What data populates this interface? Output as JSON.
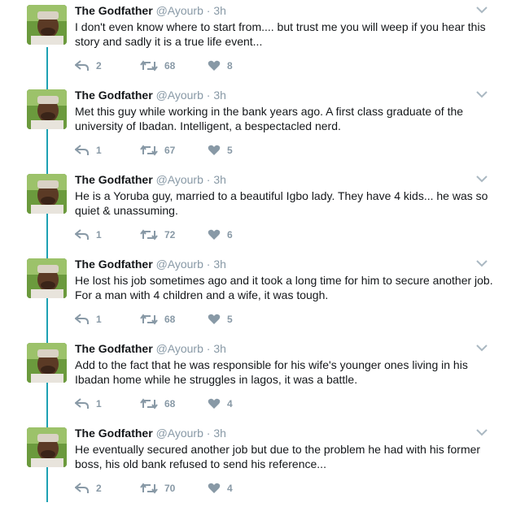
{
  "thread": {
    "tweets": [
      {
        "name": "The Godfather",
        "handle": "@Ayourb",
        "dot": "·",
        "time": "3h",
        "text": "I don't even know where to start from.... but trust me you will weep if you hear this story and sadly it is a true life event...",
        "replies": "2",
        "retweets": "68",
        "likes": "8"
      },
      {
        "name": "The Godfather",
        "handle": "@Ayourb",
        "dot": "·",
        "time": "3h",
        "text": "Met this guy while working in the bank years ago. A first class graduate of the university of Ibadan. Intelligent, a bespectacled nerd.",
        "replies": "1",
        "retweets": "67",
        "likes": "5"
      },
      {
        "name": "The Godfather",
        "handle": "@Ayourb",
        "dot": "·",
        "time": "3h",
        "text": "He is a Yoruba guy, married to a beautiful Igbo lady. They have 4 kids... he was so quiet & unassuming.",
        "replies": "1",
        "retweets": "72",
        "likes": "6"
      },
      {
        "name": "The Godfather",
        "handle": "@Ayourb",
        "dot": "·",
        "time": "3h",
        "text": "He lost his job sometimes ago and it took a long time for him to secure another job. For a man with 4 children and a wife, it was tough.",
        "replies": "1",
        "retweets": "68",
        "likes": "5"
      },
      {
        "name": "The Godfather",
        "handle": "@Ayourb",
        "dot": "·",
        "time": "3h",
        "text": "Add to the fact that he was responsible for his wife's younger ones living in his Ibadan home while he struggles in lagos, it was a battle.",
        "replies": "1",
        "retweets": "68",
        "likes": "4"
      },
      {
        "name": "The Godfather",
        "handle": "@Ayourb",
        "dot": "·",
        "time": "3h",
        "text": "He eventually secured another job but due to the problem he had with his former boss, his old bank refused to send his reference...",
        "replies": "2",
        "retweets": "70",
        "likes": "4"
      }
    ]
  },
  "colors": {
    "thread_line": "#1da1b3",
    "muted": "#8899a6",
    "text": "#14171a"
  },
  "icons": {
    "reply": "reply-icon",
    "retweet": "retweet-icon",
    "like": "heart-icon",
    "caret": "chevron-down-icon",
    "avatar": "avatar"
  }
}
